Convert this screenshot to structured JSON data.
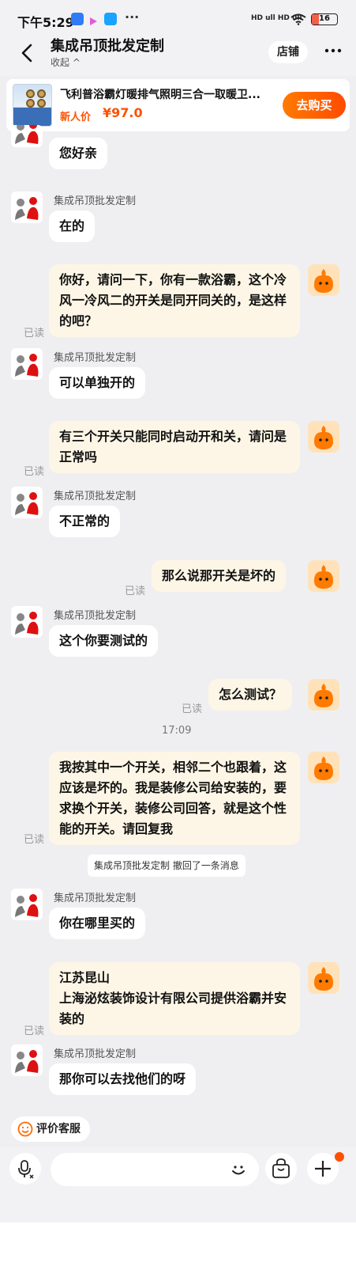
{
  "status_bar": {
    "time": "下午5:29",
    "dots": "···",
    "network": "HD ull HD ull",
    "battery": "16"
  },
  "header": {
    "title": "集成吊顶批发定制",
    "collapse": "收起 ^",
    "shop_button": "店铺"
  },
  "product": {
    "name": "飞利普浴霸灯暖排气照明三合一取暖卫...",
    "price_label": "新人价",
    "price": "¥97.0",
    "buy_button": "去购买"
  },
  "seller_name": "集成吊顶批发定制",
  "read_label": "已读",
  "messages": [
    {
      "text": "您好亲"
    },
    {
      "text": "在的"
    },
    {
      "text": "你好，请问一下，你有一款浴霸，这个冷风一冷风二的开关是同开同关的，是这样的吧？"
    },
    {
      "text": "可以单独开的"
    },
    {
      "text": "有三个开关只能同时启动开和关，请问是正常吗"
    },
    {
      "text": "不正常的"
    },
    {
      "text": "那么说那开关是坏的"
    },
    {
      "text": "这个你要测试的"
    },
    {
      "text": "怎么测试？"
    },
    {
      "text": "我按其中一个开关，相邻二个也跟着，这应该是坏的。我是装修公司给安装的，要求换个开关，装修公司回答，就是这个性能的开关。请回复我"
    },
    {
      "text": "你在哪里买的"
    },
    {
      "text": "江苏昆山\n上海泌炫装饰设计有限公司提供浴霸并安装的"
    },
    {
      "text": "那你可以去找他们的呀"
    }
  ],
  "timestamp": "17:09",
  "system_message": "集成吊顶批发定制 撤回了一条消息",
  "rate_button": "评价客服",
  "input_bar": {
    "voice": "voice-icon",
    "emoji": "emoji-icon",
    "bag": "shopping-bag-icon",
    "plus": "plus-icon"
  },
  "colors": {
    "accent": "#ff5000",
    "out_bubble": "#fdf6e6",
    "background": "#efeff1"
  }
}
